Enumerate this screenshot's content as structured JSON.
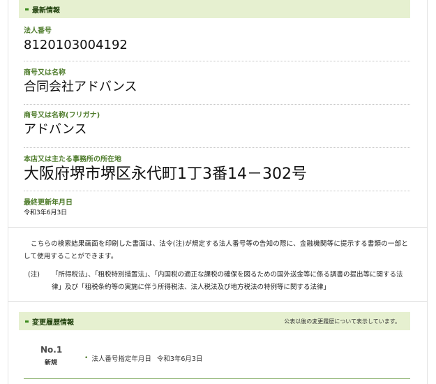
{
  "latest": {
    "header": "最新情報",
    "fields": [
      {
        "label": "法人番号",
        "value": "8120103004192"
      },
      {
        "label": "商号又は名称",
        "value": "合同会社アドバンス"
      },
      {
        "label": "商号又は名称(フリガナ)",
        "value": "アドバンス"
      },
      {
        "label": "本店又は主たる事務所の所在地",
        "value": "大阪府堺市堺区永代町1丁3番14－302号"
      },
      {
        "label": "最終更新年月日",
        "value": "令和3年6月3日"
      }
    ]
  },
  "notice": {
    "paragraph": "こちらの検索結果画面を印刷した書面は、法令(注)が規定する法人番号等の告知の際に、金融機関等に提示する書類の一部として使用することができます。",
    "note_mark": "(注)",
    "note_text": "「所得税法」、「租税特別措置法」、「内国税の適正な課税の確保を図るための国外送金等に係る調書の提出等に関する法律」及び「租税条約等の実施に伴う所得税法、法人税法及び地方税法の特例等に関する法律」"
  },
  "history": {
    "header": "変更履歴情報",
    "note": "公表以後の変更履歴について表示しています。",
    "entries": [
      {
        "number": "No.1",
        "tag": "新規",
        "item_label": "法人番号指定年月日",
        "item_value": "令和3年6月3日"
      }
    ]
  },
  "colors": {
    "bar_bg": "#e6f0d0",
    "accent": "#4f7c2c",
    "marker": "#3b8a1c"
  }
}
